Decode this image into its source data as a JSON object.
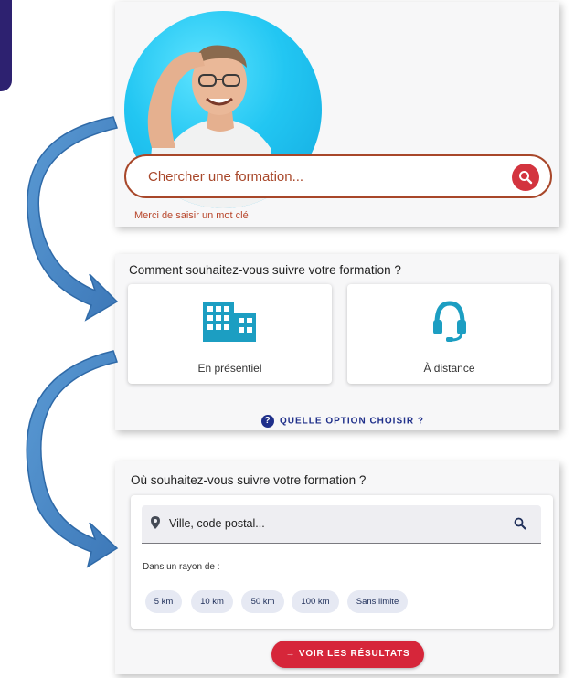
{
  "search": {
    "placeholder": "Chercher une formation...",
    "hint": "Merci de saisir un mot clé"
  },
  "mode": {
    "question": "Comment souhaitez-vous suivre votre formation ?",
    "options": [
      {
        "label": "En présentiel",
        "icon": "building-icon"
      },
      {
        "label": "À distance",
        "icon": "headset-icon"
      }
    ],
    "help_link": "QUELLE OPTION CHOISIR ?"
  },
  "location": {
    "question": "Où souhaitez-vous suivre votre formation ?",
    "placeholder": "Ville, code postal...",
    "radius_label": "Dans un rayon de :",
    "radius_options": [
      "5 km",
      "10 km",
      "50 km",
      "100 km",
      "Sans limite"
    ],
    "results_button": "VOIR LES RÉSULTATS"
  },
  "colors": {
    "accent_red": "#d6263a",
    "search_border": "#a8472a",
    "icon_teal": "#1c9ec2",
    "navy": "#1f2f8a",
    "arrow_blue": "#4a88c8"
  }
}
